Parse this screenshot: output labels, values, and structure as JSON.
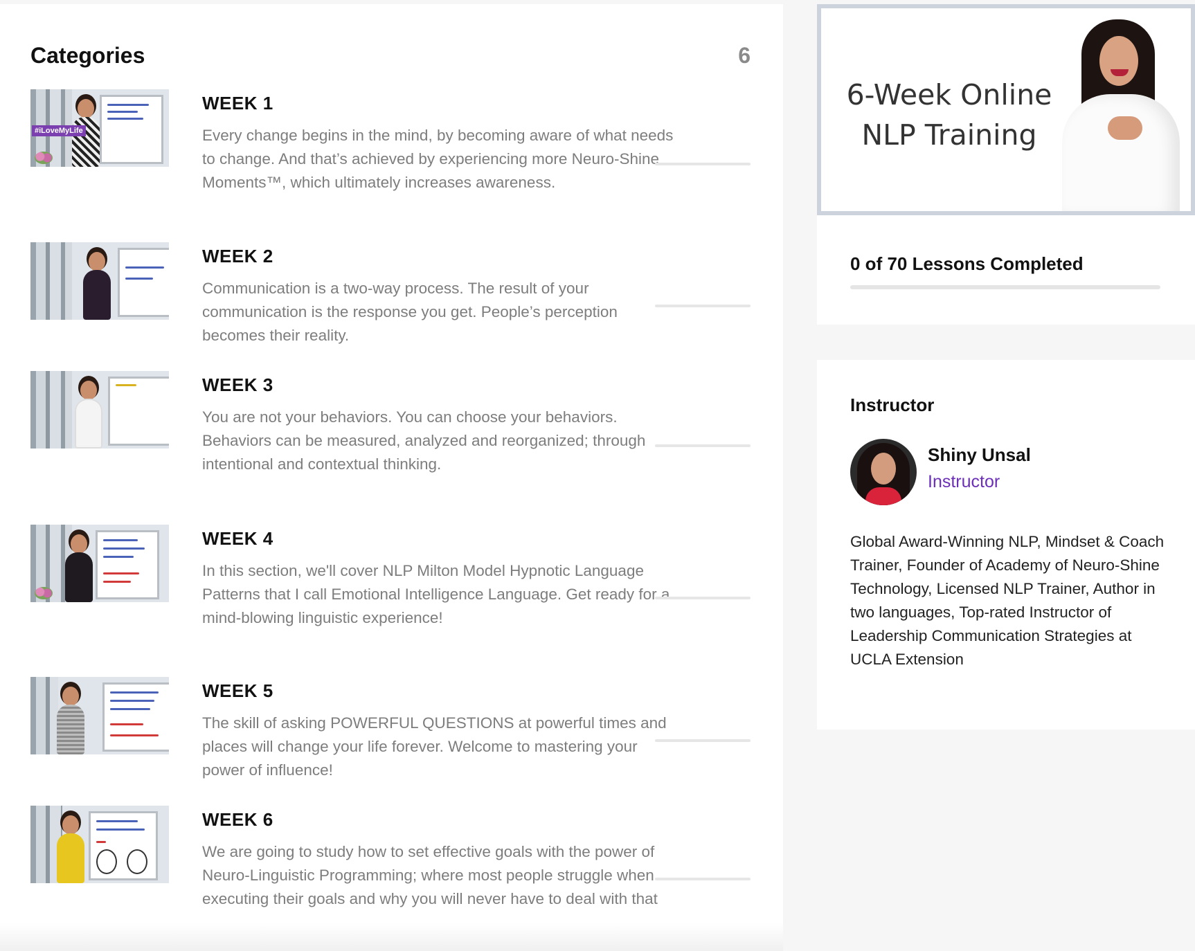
{
  "categories": {
    "title": "Categories",
    "count": "6",
    "weeks": [
      {
        "title": "WEEK 1",
        "description": "Every change begins in the mind, by becoming aware of what needs to change. And that’s achieved by experiencing more Neuro-Shine Moments™, which ultimately increases awareness.",
        "thumbnail_sign": "#iLoveMyLife",
        "progress": 0
      },
      {
        "title": "WEEK 2",
        "description": "Communication is a two-way process. The result of your communication is the response you get. People’s perception becomes their reality.",
        "progress": 0
      },
      {
        "title": "WEEK 3",
        "description": "You are not your behaviors. You can choose your behaviors. Behaviors can be measured, analyzed and reorganized; through intentional and contextual thinking.",
        "progress": 0
      },
      {
        "title": "WEEK 4",
        "description": "In this section, we'll cover NLP Milton Model Hypnotic Language Patterns that I call Emotional Intelligence Language. Get ready for a mind-blowing linguistic experience!",
        "progress": 0
      },
      {
        "title": "WEEK 5",
        "description": "The skill of asking POWERFUL QUESTIONS at powerful times and places will change your life forever. Welcome to mastering your power of influence!",
        "progress": 0
      },
      {
        "title": "WEEK 6",
        "description": "We are going to study how to set effective goals with the power of Neuro-Linguistic Programming; where most people struggle when executing their goals and why you will never have to deal with that",
        "progress": 0
      }
    ]
  },
  "course": {
    "banner_title_line1": "6-Week Online",
    "banner_title_line2": "NLP Training",
    "lessons_completed_text": "0 of 70 Lessons Completed",
    "lessons_completed": 0,
    "lessons_total": 70
  },
  "instructor": {
    "heading": "Instructor",
    "name": "Shiny Unsal",
    "role": "Instructor",
    "bio": "Global Award-Winning NLP, Mindset & Coach Trainer, Founder of Academy of Neuro-Shine Technology, Licensed NLP Trainer, Author in two languages, Top-rated Instructor of Leadership Communication Strategies at UCLA Extension"
  },
  "colors": {
    "accent": "#6b2fb8",
    "muted_text": "#7d7d7d",
    "progress_track": "#e6e6e6",
    "banner_border": "#ccd3dc"
  }
}
